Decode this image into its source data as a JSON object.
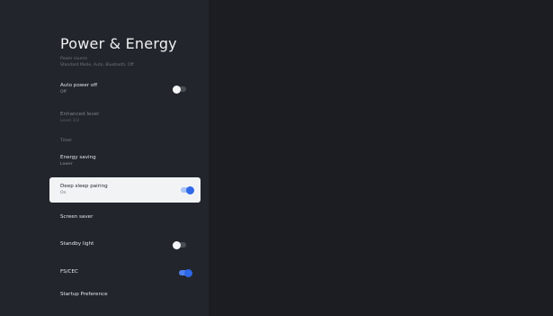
{
  "page": {
    "title": "Power & Energy",
    "subtitle_line1": "Power source",
    "subtitle_line2": "Standard Mode, Auto, Bluetooth, Off"
  },
  "settings": {
    "auto_power_off": {
      "label": "Auto power off",
      "value": "Off",
      "toggle": "off"
    },
    "energy_level": {
      "label": "Enhanced level",
      "value": "Level 1/3"
    },
    "section_header": "Timer",
    "energy_saving": {
      "label": "Energy saving",
      "value": "Lower"
    },
    "deep_sleep": {
      "label": "Deep sleep pairing",
      "value": "On",
      "toggle": "on"
    },
    "screen_saver": {
      "label": "Screen saver"
    },
    "standby_light": {
      "label": "Standby light",
      "toggle": "off"
    },
    "fs_cec": {
      "label": "FS/CEC",
      "toggle": "on"
    },
    "startup_preference": {
      "label": "Startup Preference"
    }
  },
  "colors": {
    "background": "#1b1d22",
    "panel": "#22262c",
    "selected": "#f1f3f5",
    "accent": "#2e66e8"
  }
}
